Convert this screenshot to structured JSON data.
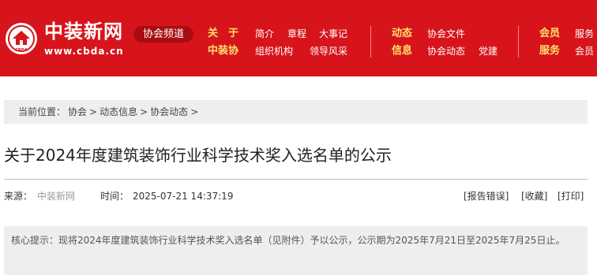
{
  "header": {
    "logo_name": "中装新网",
    "logo_url": "www.cbda.cn",
    "logo_emblem_text": "CBDA",
    "channel_label": "协会频道",
    "groups": [
      {
        "title": [
          "关　于",
          "中装协"
        ],
        "links": [
          [
            "简介",
            "章程",
            "大事记"
          ],
          [
            "组织机构",
            "领导风采"
          ]
        ]
      },
      {
        "title": [
          "动态",
          "信息"
        ],
        "links": [
          [
            "协会文件"
          ],
          [
            "协会动态",
            "党建"
          ]
        ]
      },
      {
        "title": [
          "会员",
          "服务"
        ],
        "links": [
          [
            "服务"
          ],
          [
            "会员"
          ]
        ]
      }
    ],
    "colors": {
      "background": "#d7141b",
      "accent_text": "#ffe16b",
      "pill": "#a80d12"
    }
  },
  "breadcrumb": {
    "label": "当前位置：",
    "items": [
      "协会",
      "动态信息",
      "协会动态"
    ],
    "separator": ">"
  },
  "article": {
    "title": "关于2024年度建筑装饰行业科学技术奖入选名单的公示",
    "source_label": "来源：",
    "source_value": "中装新网",
    "time_label": "时间：",
    "time_value": "2025-07-21 14:37:19",
    "actions": [
      "[报告错误]",
      "[收藏]",
      "[打印]"
    ],
    "summary_label": "核心提示：",
    "summary_text": "现将2024年度建筑装饰行业科学技术奖入选名单（见附件）予以公示，公示期为2025年7月21日至2025年7月25日止。"
  }
}
